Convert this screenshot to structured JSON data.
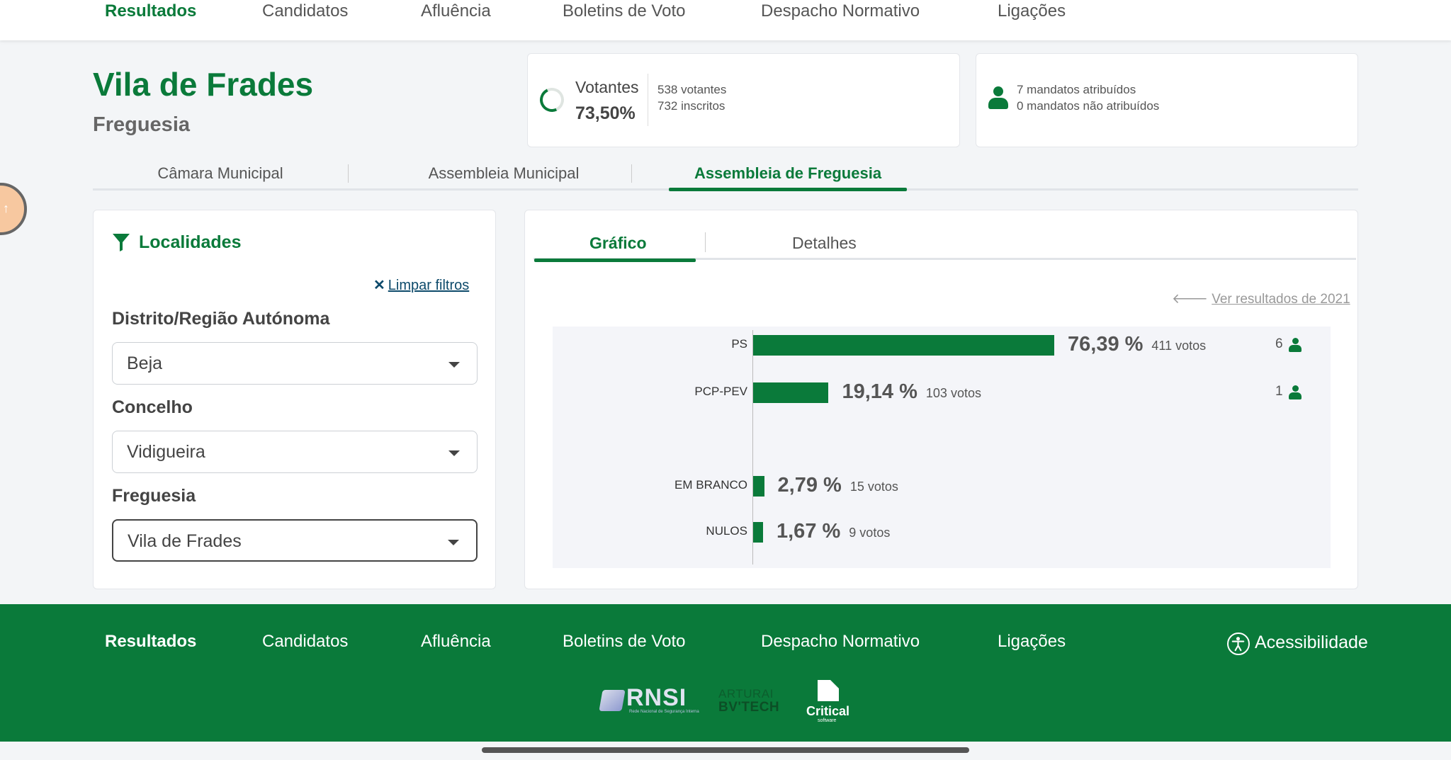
{
  "nav": {
    "items": [
      "Resultados",
      "Candidatos",
      "Afluência",
      "Boletins de Voto",
      "Despacho Normativo",
      "Ligações"
    ],
    "active_index": 0
  },
  "header": {
    "title": "Vila de Frades",
    "subtitle": "Freguesia"
  },
  "turnout": {
    "label": "Votantes",
    "percent": "73,50%",
    "voters": "538 votantes",
    "registered": "732 inscritos",
    "percent_value": 73.5,
    "icon": "progress-ring"
  },
  "mandates": {
    "assigned": "7 mandatos atribuídos",
    "unassigned": "0 mandatos não atribuídos",
    "icon": "person-icon"
  },
  "org_tabs": {
    "items": [
      "Câmara Municipal",
      "Assembleia Municipal",
      "Assembleia de Freguesia"
    ],
    "active_index": 2
  },
  "filters": {
    "title": "Localidades",
    "clear_label": "Limpar filtros",
    "district_label": "Distrito/Região Autónoma",
    "district_value": "Beja",
    "municipality_label": "Concelho",
    "municipality_value": "Vidigueira",
    "parish_label": "Freguesia",
    "parish_value": "Vila de Frades"
  },
  "results_tabs": {
    "items": [
      "Gráfico",
      "Detalhes"
    ],
    "active_index": 0
  },
  "previous_results_label": "Ver resultados de 2021",
  "chart_data": {
    "type": "bar",
    "orientation": "horizontal",
    "categories": [
      "PS",
      "PCP-PEV",
      "EM BRANCO",
      "NULOS"
    ],
    "values": [
      76.39,
      19.14,
      2.79,
      1.67
    ],
    "value_labels": [
      "76,39 %",
      "19,14 %",
      "2,79 %",
      "1,67 %"
    ],
    "votes_labels": [
      "411 votos",
      "103 votos",
      "15 votos",
      "9 votos"
    ],
    "mandates": [
      "6",
      "1",
      "",
      ""
    ],
    "xlim": [
      0,
      76.39
    ],
    "color": "#0a7a3a"
  },
  "footer": {
    "nav_items": [
      "Resultados",
      "Candidatos",
      "Afluência",
      "Boletins de Voto",
      "Despacho Normativo",
      "Ligações"
    ],
    "accessibility_label": "Acessibilidade",
    "logos": [
      {
        "name": "RNSI",
        "tagline": "Rede Nacional de Segurança Interna"
      },
      {
        "name_line1": "ARTURAI",
        "name_line2": "BV'TECH"
      },
      {
        "name": "Critical",
        "tagline": "software"
      }
    ]
  },
  "colors": {
    "brand_green": "#0a7a3a",
    "page_background": "#f3f5f7",
    "chart_background": "#f4f5f9"
  }
}
